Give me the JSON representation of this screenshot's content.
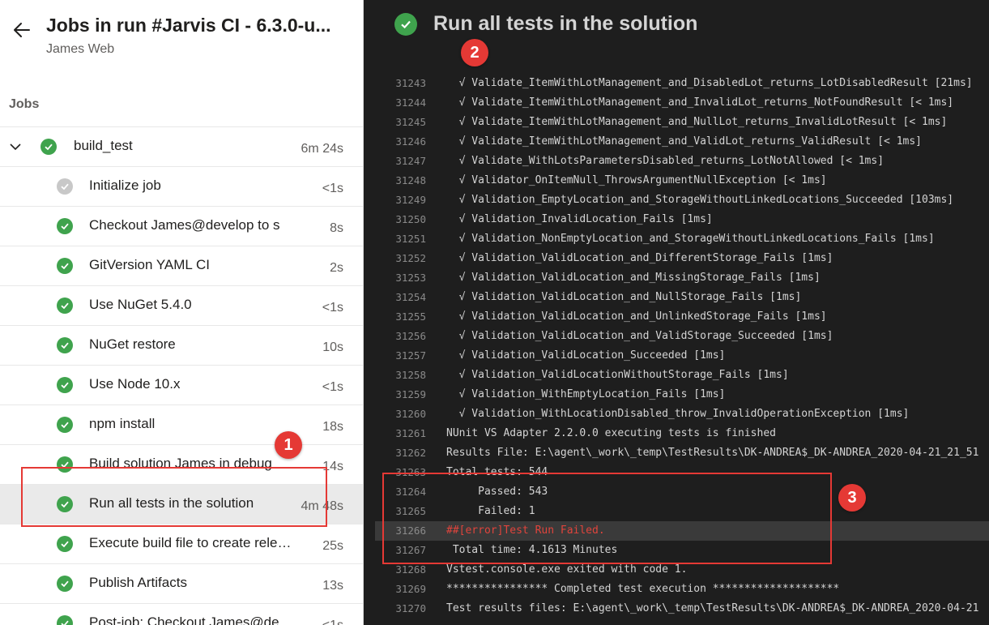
{
  "header": {
    "title": "Jobs in run #Jarvis CI - 6.3.0-u...",
    "subtitle": "James Web"
  },
  "jobs_heading": "Jobs",
  "job": {
    "name": "build_test",
    "duration": "6m 24s",
    "steps": [
      {
        "label": "Initialize job",
        "duration": "<1s",
        "status": "skipped"
      },
      {
        "label": "Checkout James@develop to s",
        "duration": "8s",
        "status": "succeeded"
      },
      {
        "label": "GitVersion YAML CI",
        "duration": "2s",
        "status": "succeeded"
      },
      {
        "label": "Use NuGet 5.4.0",
        "duration": "<1s",
        "status": "succeeded"
      },
      {
        "label": "NuGet restore",
        "duration": "10s",
        "status": "succeeded"
      },
      {
        "label": "Use Node 10.x",
        "duration": "<1s",
        "status": "succeeded"
      },
      {
        "label": "npm install",
        "duration": "18s",
        "status": "succeeded"
      },
      {
        "label": "Build solution James in debug",
        "duration": "14s",
        "status": "succeeded"
      },
      {
        "label": "Run all tests in the solution",
        "duration": "4m 48s",
        "status": "succeeded",
        "selected": true
      },
      {
        "label": "Execute build file to create release",
        "duration": "25s",
        "status": "succeeded"
      },
      {
        "label": "Publish Artifacts",
        "duration": "13s",
        "status": "succeeded"
      },
      {
        "label": "Post-job: Checkout James@deve...",
        "duration": "<1s",
        "status": "succeeded"
      }
    ]
  },
  "log": {
    "title": "Run all tests in the solution",
    "lines": [
      {
        "n": "31243",
        "t": "  √ Validate_ItemWithLotManagement_and_DisabledLot_returns_LotDisabledResult [21ms]"
      },
      {
        "n": "31244",
        "t": "  √ Validate_ItemWithLotManagement_and_InvalidLot_returns_NotFoundResult [< 1ms]"
      },
      {
        "n": "31245",
        "t": "  √ Validate_ItemWithLotManagement_and_NullLot_returns_InvalidLotResult [< 1ms]"
      },
      {
        "n": "31246",
        "t": "  √ Validate_ItemWithLotManagement_and_ValidLot_returns_ValidResult [< 1ms]"
      },
      {
        "n": "31247",
        "t": "  √ Validate_WithLotsParametersDisabled_returns_LotNotAllowed [< 1ms]"
      },
      {
        "n": "31248",
        "t": "  √ Validator_OnItemNull_ThrowsArgumentNullException [< 1ms]"
      },
      {
        "n": "31249",
        "t": "  √ Validation_EmptyLocation_and_StorageWithoutLinkedLocations_Succeeded [103ms]"
      },
      {
        "n": "31250",
        "t": "  √ Validation_InvalidLocation_Fails [1ms]"
      },
      {
        "n": "31251",
        "t": "  √ Validation_NonEmptyLocation_and_StorageWithoutLinkedLocations_Fails [1ms]"
      },
      {
        "n": "31252",
        "t": "  √ Validation_ValidLocation_and_DifferentStorage_Fails [1ms]"
      },
      {
        "n": "31253",
        "t": "  √ Validation_ValidLocation_and_MissingStorage_Fails [1ms]"
      },
      {
        "n": "31254",
        "t": "  √ Validation_ValidLocation_and_NullStorage_Fails [1ms]"
      },
      {
        "n": "31255",
        "t": "  √ Validation_ValidLocation_and_UnlinkedStorage_Fails [1ms]"
      },
      {
        "n": "31256",
        "t": "  √ Validation_ValidLocation_and_ValidStorage_Succeeded [1ms]"
      },
      {
        "n": "31257",
        "t": "  √ Validation_ValidLocation_Succeeded [1ms]"
      },
      {
        "n": "31258",
        "t": "  √ Validation_ValidLocationWithoutStorage_Fails [1ms]"
      },
      {
        "n": "31259",
        "t": "  √ Validation_WithEmptyLocation_Fails [1ms]"
      },
      {
        "n": "31260",
        "t": "  √ Validation_WithLocationDisabled_throw_InvalidOperationException [1ms]"
      },
      {
        "n": "31261",
        "t": "NUnit VS Adapter 2.2.0.0 executing tests is finished"
      },
      {
        "n": "31262",
        "t": "Results File: E:\\agent\\_work\\_temp\\TestResults\\DK-ANDREA$_DK-ANDREA_2020-04-21_21_51"
      },
      {
        "n": "31263",
        "t": "Total tests: 544"
      },
      {
        "n": "31264",
        "t": "     Passed: 543"
      },
      {
        "n": "31265",
        "t": "     Failed: 1"
      },
      {
        "n": "31266",
        "t": "##[error]Test Run Failed.",
        "error": true
      },
      {
        "n": "31267",
        "t": " Total time: 4.1613 Minutes"
      },
      {
        "n": "31268",
        "t": "Vstest.console.exe exited with code 1."
      },
      {
        "n": "31269",
        "t": "**************** Completed test execution ********************"
      },
      {
        "n": "31270",
        "t": "Test results files: E:\\agent\\_work\\_temp\\TestResults\\DK-ANDREA$_DK-ANDREA_2020-04-21"
      }
    ]
  },
  "annotations": [
    "1",
    "2",
    "3"
  ],
  "colors": {
    "success": "#3fa34d",
    "skipped": "#c8c8c8",
    "annotation": "#e53935",
    "error_text": "#e0443c"
  }
}
